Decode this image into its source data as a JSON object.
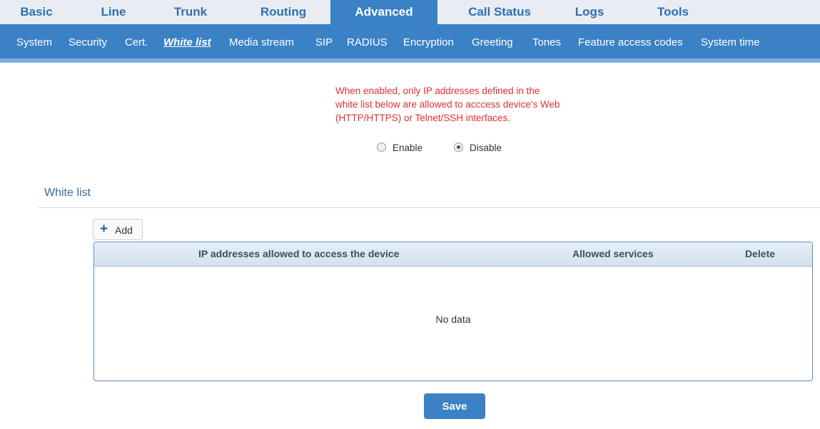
{
  "top_tabs": [
    "Basic",
    "Line",
    "Trunk",
    "Routing",
    "Advanced",
    "Call Status",
    "Logs",
    "Tools"
  ],
  "active_top_tab": "Advanced",
  "sub_tabs": [
    "System",
    "Security",
    "Cert.",
    "White list",
    "Media stream",
    "SIP",
    "RADIUS",
    "Encryption",
    "Greeting",
    "Tones",
    "Feature access codes",
    "System time"
  ],
  "active_sub_tab": "White list",
  "notice": "When enabled, only IP addresses defined in the white list below are allowed to acccess device's Web (HTTP/HTTPS) or Telnet/SSH interfaces.",
  "radio": {
    "enable_label": "Enable",
    "disable_label": "Disable",
    "selected": "Disable"
  },
  "section_title": "White list",
  "add_button_label": "Add",
  "table": {
    "columns": [
      "IP addresses allowed to access the device",
      "Allowed services",
      "Delete"
    ],
    "rows": [],
    "empty_text": "No data"
  },
  "save_button_label": "Save",
  "colors": {
    "accent": "#3a81c6",
    "notice": "#e03030"
  }
}
